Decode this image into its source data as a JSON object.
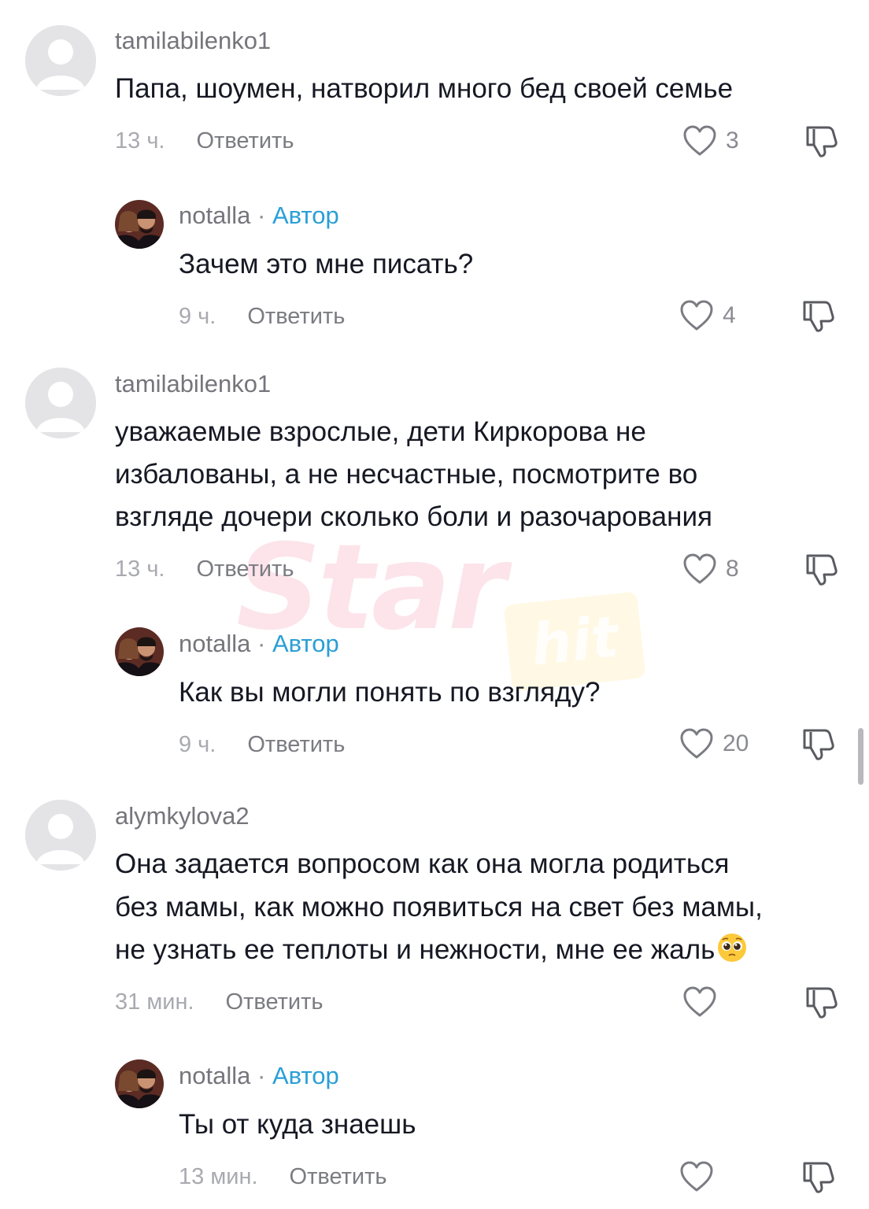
{
  "comments": [
    {
      "username": "tamilabilenko1",
      "text": "Папа, шоумен, натворил много бед своей семье",
      "time": "13 ч.",
      "reply_label": "Ответить",
      "likes": "3"
    },
    {
      "username": "notalla",
      "separator": "·",
      "author_badge": "Автор",
      "text": "Зачем это мне писать?",
      "time": "9 ч.",
      "reply_label": "Ответить",
      "likes": "4"
    },
    {
      "username": "tamilabilenko1",
      "text_lines": [
        "уважаемые взрослые, дети Киркорова не",
        "избалованы, а не несчастные, посмотрите во",
        "взгляде дочери сколько боли и разочарования"
      ],
      "time": "13 ч.",
      "reply_label": "Ответить",
      "likes": "8"
    },
    {
      "username": "notalla",
      "separator": "·",
      "author_badge": "Автор",
      "text": "Как вы могли понять по взгляду?",
      "time": "9 ч.",
      "reply_label": "Ответить",
      "likes": "20"
    },
    {
      "username": "alymkylova2",
      "text_lines": [
        "Она задается вопросом как она могла родиться",
        "без мамы, как можно появиться на свет без мамы,",
        "не узнать ее теплоты и нежности, мне ее жаль"
      ],
      "emoji": "pleading-face",
      "time": "31 мин.",
      "reply_label": "Ответить",
      "likes": ""
    },
    {
      "username": "notalla",
      "separator": "·",
      "author_badge": "Автор",
      "text": "Ты от куда знаешь",
      "time": "13 мин.",
      "reply_label": "Ответить",
      "likes": ""
    }
  ],
  "watermark": {
    "brand": "Star",
    "sub": "hit"
  },
  "colors": {
    "text": "#161823",
    "muted": "#75757c",
    "author": "#2a9fd6",
    "watermark_pink": "#eb2d5a",
    "watermark_yellow": "#ffd65a"
  },
  "icons": [
    "default-avatar-icon",
    "profile-photo-avatar",
    "heart-outline-icon",
    "thumbs-down-icon",
    "pleading-face-emoji"
  ]
}
